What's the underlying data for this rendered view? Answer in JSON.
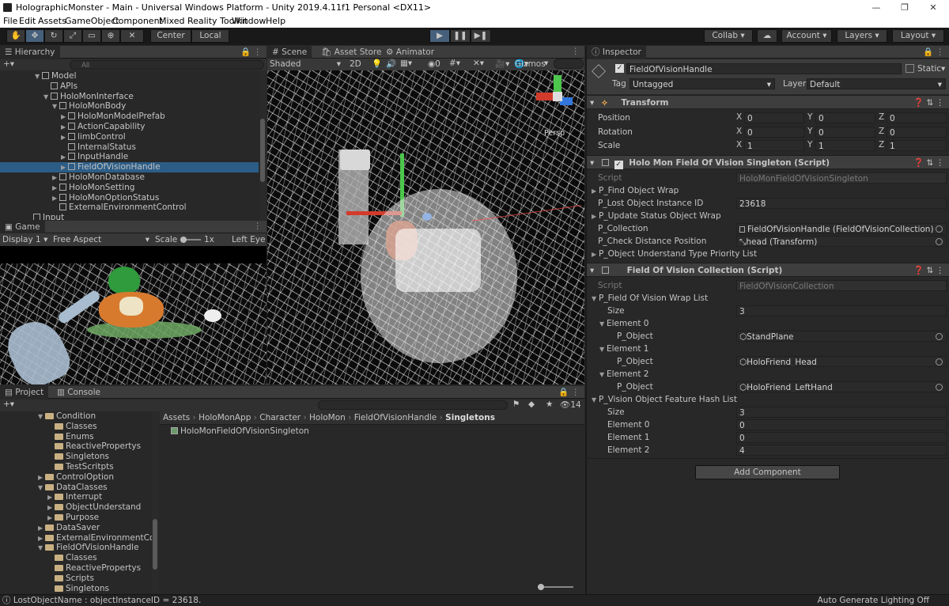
{
  "window": {
    "title": "HolographicMonster - Main - Universal Windows Platform - Unity 2019.4.11f1 Personal <DX11>",
    "minimize": "—",
    "maximize": "❐",
    "close": "✕"
  },
  "menu": [
    "File",
    "Edit",
    "Assets",
    "GameObject",
    "Component",
    "Mixed Reality Toolkit",
    "Window",
    "Help"
  ],
  "toolbar": {
    "center_label": "Center",
    "local_label": "Local",
    "collab_label": "Collab ▾",
    "account_label": "Account",
    "layers_label": "Layers",
    "layout_label": "Layout"
  },
  "hierarchy": {
    "tab": "Hierarchy",
    "search_placeholder": "All",
    "items": [
      {
        "label": "Model",
        "indent": 4
      },
      {
        "label": "APIs",
        "indent": 5
      },
      {
        "label": "HoloMonInterface",
        "indent": 5
      },
      {
        "label": "HoloMonBody",
        "indent": 6
      },
      {
        "label": "HoloMonModelPrefab",
        "indent": 7
      },
      {
        "label": "ActionCapability",
        "indent": 7
      },
      {
        "label": "limbControl",
        "indent": 7
      },
      {
        "label": "InternalStatus",
        "indent": 7
      },
      {
        "label": "InputHandle",
        "indent": 7
      },
      {
        "label": "FieldOfVisionHandle",
        "indent": 7
      },
      {
        "label": "HoloMonDatabase",
        "indent": 6
      },
      {
        "label": "HoloMonSetting",
        "indent": 6
      },
      {
        "label": "HoloMonOptionStatus",
        "indent": 6
      },
      {
        "label": "ExternalEnvironmentControl",
        "indent": 6
      },
      {
        "label": "Input",
        "indent": 3
      }
    ]
  },
  "game": {
    "tab": "Game",
    "display": "Display 1",
    "aspect": "Free Aspect",
    "scale_label": "Scale",
    "scale_value": "1x",
    "eye": "Left Eye"
  },
  "scene": {
    "tabs": [
      "Scene",
      "Asset Store",
      "Animator"
    ],
    "shading": "Shaded",
    "mode_2d": "2D",
    "fx_count": "0",
    "gizmos": "Gizmos",
    "persp": "Persp"
  },
  "project": {
    "tabs": [
      "Project",
      "Console"
    ],
    "breadcrumb": [
      "Assets",
      "HoloMonApp",
      "Character",
      "HoloMon",
      "FieldOfVisionHandle",
      "Singletons"
    ],
    "file": "HoloMonFieldOfVisionSingleton",
    "hidden_count": "14",
    "tree": [
      {
        "label": "Condition",
        "indent": 4,
        "fold": "▼"
      },
      {
        "label": "Classes",
        "indent": 5,
        "fold": ""
      },
      {
        "label": "Enums",
        "indent": 5,
        "fold": ""
      },
      {
        "label": "ReactivePropertys",
        "indent": 5,
        "fold": ""
      },
      {
        "label": "Singletons",
        "indent": 5,
        "fold": ""
      },
      {
        "label": "TestScritpts",
        "indent": 5,
        "fold": ""
      },
      {
        "label": "ControlOption",
        "indent": 4,
        "fold": "▶"
      },
      {
        "label": "DataClasses",
        "indent": 4,
        "fold": "▼"
      },
      {
        "label": "Interrupt",
        "indent": 5,
        "fold": "▶"
      },
      {
        "label": "ObjectUnderstand",
        "indent": 5,
        "fold": "▶"
      },
      {
        "label": "Purpose",
        "indent": 5,
        "fold": "▶"
      },
      {
        "label": "DataSaver",
        "indent": 4,
        "fold": "▶"
      },
      {
        "label": "ExternalEnvironmentConti",
        "indent": 4,
        "fold": "▶"
      },
      {
        "label": "FieldOfVisionHandle",
        "indent": 4,
        "fold": "▼"
      },
      {
        "label": "Classes",
        "indent": 5,
        "fold": ""
      },
      {
        "label": "ReactivePropertys",
        "indent": 5,
        "fold": ""
      },
      {
        "label": "Scripts",
        "indent": 5,
        "fold": ""
      },
      {
        "label": "Singletons",
        "indent": 5,
        "fold": ""
      }
    ]
  },
  "inspector": {
    "tab": "Inspector",
    "object_name": "FieldOfVisionHandle",
    "static_label": "Static",
    "tag_label": "Tag",
    "tag_value": "Untagged",
    "layer_label": "Layer",
    "layer_value": "Default",
    "transform": {
      "title": "Transform",
      "rows": [
        {
          "label": "Position",
          "x": "0",
          "y": "0",
          "z": "0"
        },
        {
          "label": "Rotation",
          "x": "0",
          "y": "0",
          "z": "0"
        },
        {
          "label": "Scale",
          "x": "1",
          "y": "1",
          "z": "1"
        }
      ]
    },
    "axis_x": "X",
    "axis_y": "Y",
    "axis_z": "Z",
    "singleton": {
      "title": "Holo Mon Field Of Vision Singleton (Script)",
      "script_label": "Script",
      "script_value": "HoloMonFieldOfVisionSingleton",
      "find_wrap": "P_Find Object Wrap",
      "lost_id_label": "P_Lost Object Instance ID",
      "lost_id_value": "23618",
      "update_wrap": "P_Update Status Object Wrap",
      "collection_label": "P_Collection",
      "collection_value": "FieldOfVisionHandle (FieldOfVisionCollection)",
      "distance_label": "P_Check Distance Position",
      "distance_value": "head (Transform)",
      "priority_list": "P_Object Understand Type Priority List"
    },
    "collection": {
      "title": "Field Of Vision Collection (Script)",
      "script_label": "Script",
      "script_value": "FieldOfVisionCollection",
      "wrap_list": "P_Field Of Vision Wrap List",
      "size_label": "Size",
      "size_value": "3",
      "elements": [
        {
          "label": "Element 0",
          "obj_label": "P_Object",
          "obj_value": "StandPlane"
        },
        {
          "label": "Element 1",
          "obj_label": "P_Object",
          "obj_value": "HoloFriend_Head"
        },
        {
          "label": "Element 2",
          "obj_label": "P_Object",
          "obj_value": "HoloFriend_LeftHand"
        }
      ],
      "hash_list": "P_Vision Object Feature Hash List",
      "hash_size_label": "Size",
      "hash_size_value": "3",
      "hash_elements": [
        {
          "label": "Element 0",
          "value": "0"
        },
        {
          "label": "Element 1",
          "value": "0"
        },
        {
          "label": "Element 2",
          "value": "4"
        }
      ]
    },
    "add_component": "Add Component"
  },
  "status": {
    "message": "LostObjectName : objectInstanceID = 23618.",
    "right": "Auto Generate Lighting Off"
  }
}
